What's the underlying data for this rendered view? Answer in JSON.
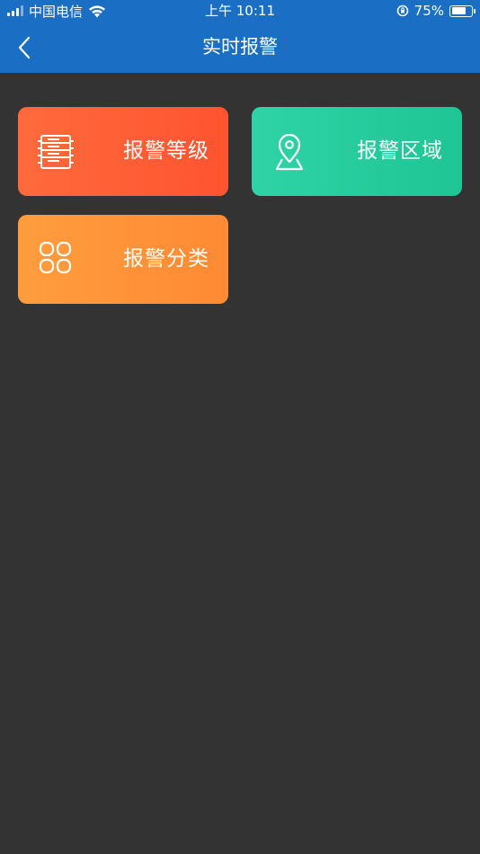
{
  "status_bar": {
    "carrier": "中国电信",
    "time": "上午 10:11",
    "battery_percent": "75%",
    "battery_level": 0.75
  },
  "nav": {
    "title": "实时报警",
    "back_icon": "chevron-left-icon"
  },
  "tiles": [
    {
      "label": "报警等级",
      "icon": "server-rack-icon",
      "color": "#ff5a32"
    },
    {
      "label": "报警区域",
      "icon": "location-pin-icon",
      "color": "#22c99a"
    },
    {
      "label": "报警分类",
      "icon": "grid-four-icon",
      "color": "#ff9338"
    }
  ],
  "colors": {
    "header": "#1a6fc4",
    "background": "#333333"
  }
}
